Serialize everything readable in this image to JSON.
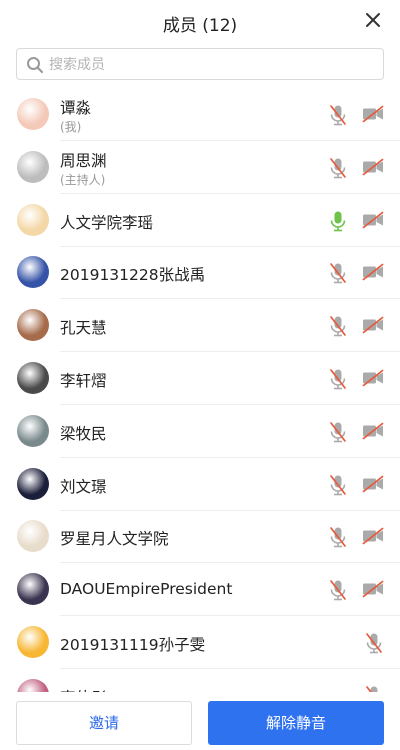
{
  "header": {
    "title": "成员 (12)"
  },
  "search": {
    "placeholder": "搜索成员"
  },
  "members": [
    {
      "name": "谭淼",
      "tag": "(我)",
      "mic": "muted",
      "camera": "off",
      "avatar_color": "#f4c9b8"
    },
    {
      "name": "周思渊",
      "tag": "(主持人)",
      "mic": "muted",
      "camera": "off",
      "avatar_color": "#bdbdbd"
    },
    {
      "name": "人文学院李瑶",
      "tag": "",
      "mic": "active",
      "camera": "off",
      "avatar_color": "#f3d7a6"
    },
    {
      "name": "2019131228张战禹",
      "tag": "",
      "mic": "muted",
      "camera": "off",
      "avatar_color": "#3553a8"
    },
    {
      "name": "孔天慧",
      "tag": "",
      "mic": "muted",
      "camera": "off",
      "avatar_color": "#a56b4a"
    },
    {
      "name": "李轩熠",
      "tag": "",
      "mic": "muted",
      "camera": "off",
      "avatar_color": "#4a4a4a"
    },
    {
      "name": "梁牧民",
      "tag": "",
      "mic": "muted",
      "camera": "off",
      "avatar_color": "#7a8a8c"
    },
    {
      "name": "刘文璟",
      "tag": "",
      "mic": "muted",
      "camera": "off",
      "avatar_color": "#1c1f3a"
    },
    {
      "name": "罗星月人文学院",
      "tag": "",
      "mic": "muted",
      "camera": "off",
      "avatar_color": "#e8dccb"
    },
    {
      "name": "DAOUEmpirePresident",
      "tag": "",
      "mic": "muted",
      "camera": "off",
      "avatar_color": "#3b3450"
    },
    {
      "name": "2019131119孙子雯",
      "tag": "",
      "mic": "muted",
      "camera": "none",
      "avatar_color": "#f7b733"
    },
    {
      "name": "李佳彤",
      "tag": "",
      "mic": "muted",
      "camera": "none",
      "avatar_color": "#c06080"
    }
  ],
  "footer": {
    "invite_label": "邀请",
    "unmute_label": "解除静音"
  },
  "colors": {
    "accent": "#2f72f0",
    "mic_muted_slash": "#e55a3c",
    "mic_active": "#6cc24a",
    "icon_gray": "#aaaaaa"
  }
}
